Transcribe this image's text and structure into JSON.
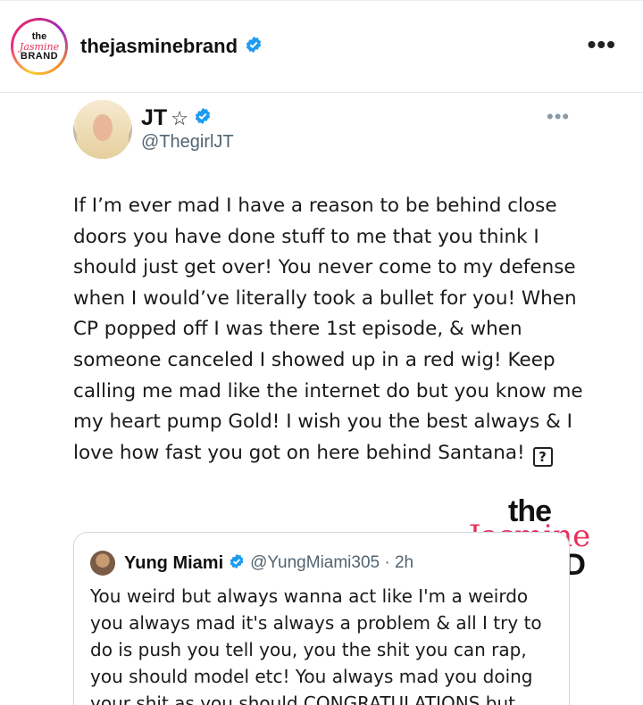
{
  "post": {
    "account": {
      "username": "thejasminebrand",
      "avatar_logo": {
        "line1": "the",
        "line2": "Jasmine",
        "line3": "BRAND"
      },
      "verified_icon": "verified-badge-icon",
      "more_icon": "more-horizontal-icon",
      "more_label": "•••"
    }
  },
  "tweet": {
    "author": {
      "name": "JT",
      "star": "☆",
      "handle": "@ThegirlJT",
      "verified_icon": "verified-badge-icon"
    },
    "more_label": "•••",
    "text": "If I’m ever mad I have a reason to be behind close doors you have done stuff to me that you think I should just get over! You never come to my defense when I would’ve literally took a bullet for you! When CP popped off I was there 1st episode, & when someone canceled I showed up in a red wig! Keep calling me mad like the internet do but you know me my heart pump Gold! I wish you the best always & I love how fast you got on here behind Santana!",
    "unknown_glyph": "?",
    "quoted": {
      "name": "Yung Miami",
      "handle_time": "@YungMiami305 · 2h",
      "text": "You weird but always wanna act like I'm a weirdo you always mad it's always a problem & all I try to do is push you tell you, you the shit you can rap, you should model etc! You always mad you doing your shit as you should CONGRATULATIONS but..."
    }
  },
  "watermark": {
    "line1": "the",
    "line2": "Jasmine",
    "line3": "BRAND"
  },
  "colors": {
    "brand_pink": "#e8305c",
    "verified_blue": "#1d9bf0",
    "handle_gray": "#536471"
  }
}
